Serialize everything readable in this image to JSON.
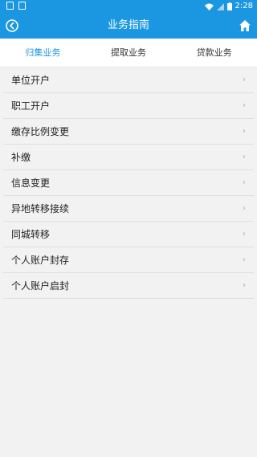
{
  "status_bar": {
    "time": "2:28"
  },
  "header": {
    "title": "业务指南"
  },
  "tabs": [
    {
      "label": "归集业务",
      "active": true
    },
    {
      "label": "提取业务",
      "active": false
    },
    {
      "label": "贷款业务",
      "active": false
    }
  ],
  "list": {
    "items": [
      {
        "label": "单位开户"
      },
      {
        "label": "职工开户"
      },
      {
        "label": "缴存比例变更"
      },
      {
        "label": "补缴"
      },
      {
        "label": "信息变更"
      },
      {
        "label": "异地转移接续"
      },
      {
        "label": "同城转移"
      },
      {
        "label": "个人账户封存"
      },
      {
        "label": "个人账户启封"
      }
    ],
    "chevron": "›"
  },
  "colors": {
    "primary": "#1a97e0",
    "background": "#f2f2f2"
  }
}
